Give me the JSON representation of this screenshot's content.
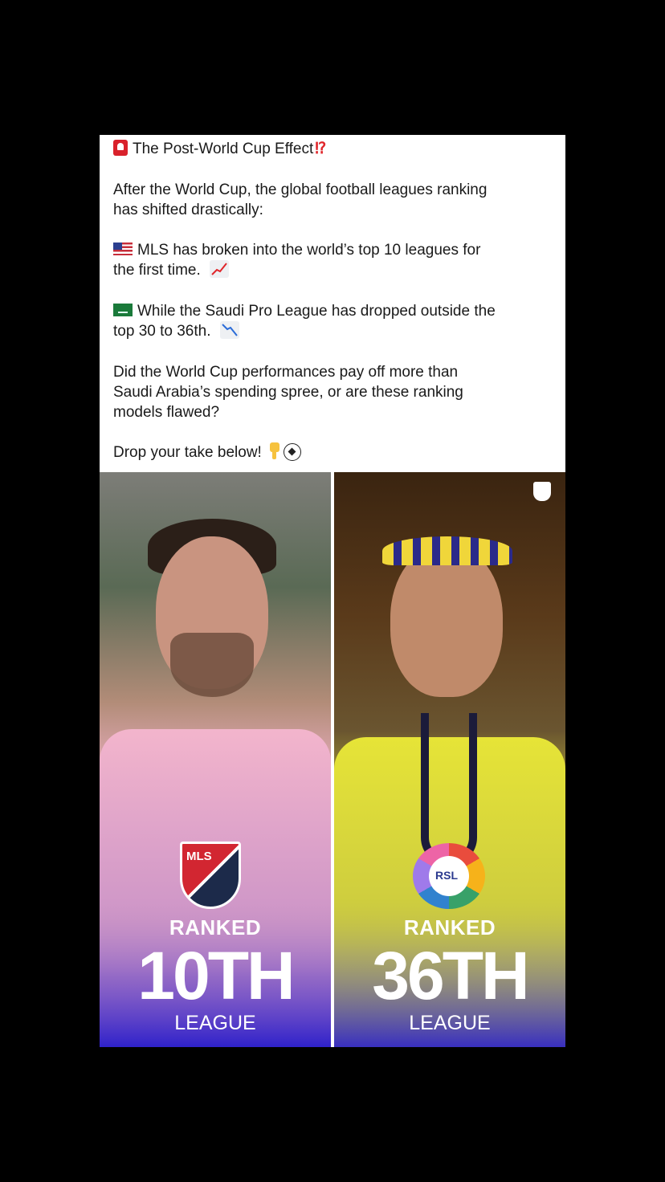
{
  "post": {
    "title": "The Post-World Cup Effect",
    "intro_line1": "After the World Cup, the global football leagues ranking",
    "intro_line2": "has shifted drastically:",
    "mls_line1": "MLS has broken into the world’s top 10 leagues for",
    "mls_line2": "the first time.",
    "spl_line1": "While the Saudi Pro League has dropped outside the",
    "spl_line2": "top 30 to 36th.",
    "question_line1": "Did the World Cup performances pay off more than",
    "question_line2": "Saudi Arabia’s spending spree, or are these ranking",
    "question_line3": "models flawed?",
    "cta": "Drop your take below!",
    "icons": [
      "siren-icon",
      "exclamation-question-icon",
      "us-flag-icon",
      "chart-increasing-icon",
      "saudi-flag-icon",
      "chart-decreasing-icon",
      "pointing-down-icon",
      "soccer-ball-icon"
    ]
  },
  "image": {
    "left": {
      "crest": "MLS",
      "ranked": "RANKED",
      "rank": "10TH",
      "league": "LEAGUE"
    },
    "right": {
      "crest": "RSL",
      "ranked": "RANKED",
      "rank": "36TH",
      "league": "LEAGUE"
    }
  }
}
